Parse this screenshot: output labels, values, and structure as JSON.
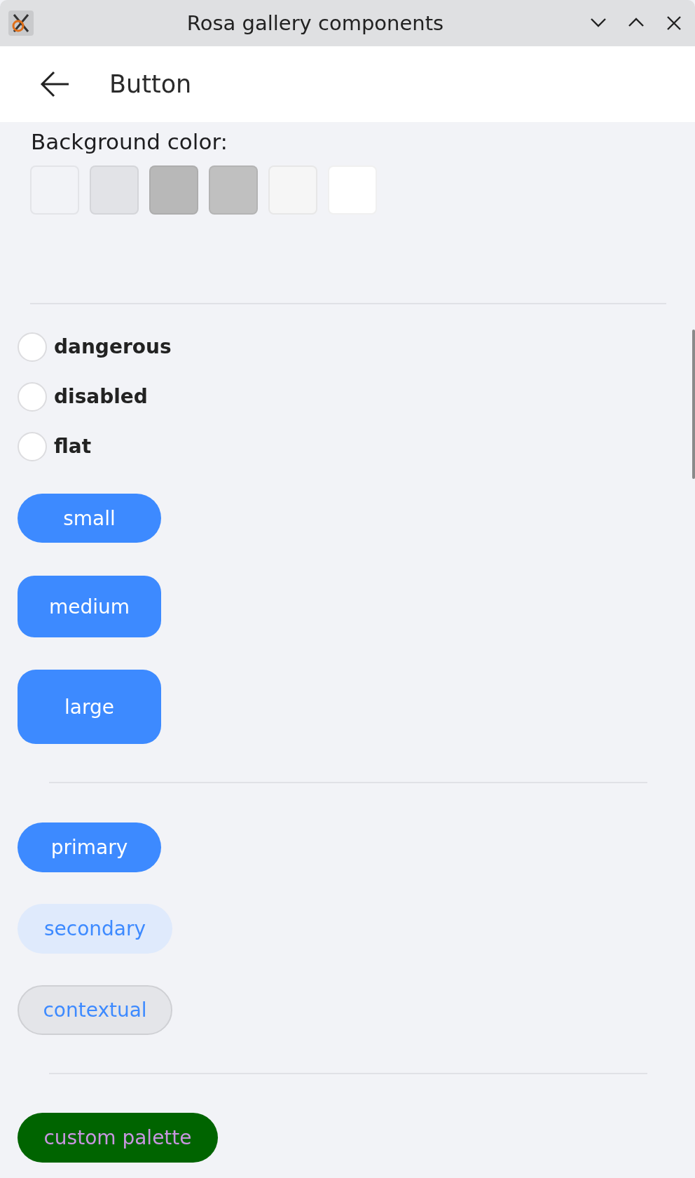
{
  "window": {
    "title": "Rosa gallery components"
  },
  "header": {
    "title": "Button"
  },
  "background_color": {
    "label": "Background color:",
    "swatches": [
      {
        "color": "#f2f3f7",
        "selected": false
      },
      {
        "color": "#e2e3e7",
        "selected": false
      },
      {
        "color": "#b8b8b8",
        "selected": false
      },
      {
        "color": "#c0c0c0",
        "selected": false
      },
      {
        "color": "#f6f6f6",
        "selected": false
      },
      {
        "color": "#ffffff",
        "selected": false
      }
    ]
  },
  "options": [
    {
      "label": "dangerous",
      "checked": false
    },
    {
      "label": "disabled",
      "checked": false
    },
    {
      "label": "flat",
      "checked": false
    }
  ],
  "button_groups": [
    [
      {
        "label": "small",
        "kind": "small"
      },
      {
        "label": "medium",
        "kind": "medium"
      },
      {
        "label": "large",
        "kind": "large"
      }
    ],
    [
      {
        "label": "primary",
        "kind": "primary"
      },
      {
        "label": "secondary",
        "kind": "secondary"
      },
      {
        "label": "contextual",
        "kind": "contextual"
      }
    ],
    [
      {
        "label": "custom palette",
        "kind": "custom"
      }
    ]
  ]
}
